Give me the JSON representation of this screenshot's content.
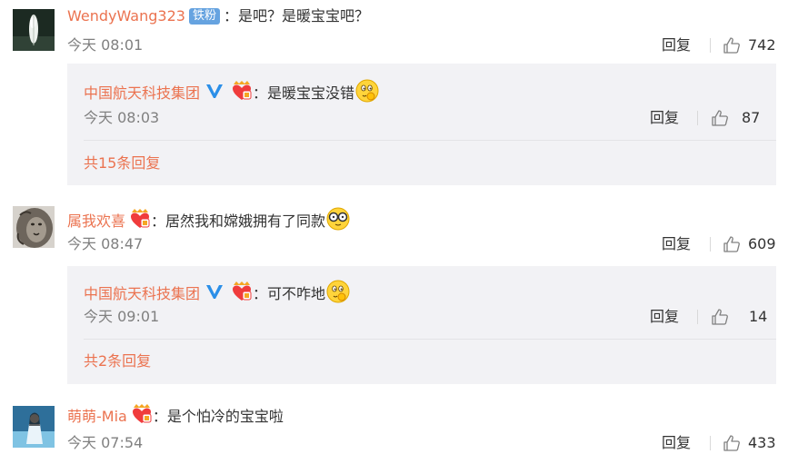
{
  "comments": [
    {
      "username": "WendyWang323",
      "badge": "铁粉",
      "separator": "：",
      "text": "是吧？是暖宝宝吧？",
      "time": "今天 08:01",
      "reply_label": "回复",
      "likes": "742",
      "avatar": "feather-avatar",
      "replies": [
        {
          "username": "中国航天科技集团",
          "separator": "：",
          "text": "是暖宝宝没错",
          "emoji": "thinking-emoji",
          "time": "今天 08:03",
          "reply_label": "回复",
          "likes": "87"
        }
      ],
      "more_label": "共15条回复"
    },
    {
      "username": "属我欢喜",
      "separator": "：",
      "text": "居然我和嫦娥拥有了同款",
      "emoji": "glasses-emoji",
      "time": "今天 08:47",
      "reply_label": "回复",
      "likes": "609",
      "avatar": "lion-avatar",
      "replies": [
        {
          "username": "中国航天科技集团",
          "separator": "：",
          "text": "可不咋地",
          "emoji": "thinking-emoji",
          "time": "今天 09:01",
          "reply_label": "回复",
          "likes": "14"
        }
      ],
      "more_label": "共2条回复"
    },
    {
      "username": "萌萌-Mia",
      "separator": "：",
      "text": "是个怕冷的宝宝啦",
      "time": "今天 07:54",
      "reply_label": "回复",
      "likes": "433",
      "avatar": "girl-avatar"
    }
  ],
  "colors": {
    "username": "#eb7350",
    "reply_box_bg": "#f2f2f5",
    "time": "#808080",
    "verified_blue": "#2b8fe8",
    "iron_badge": "#66a3e0"
  }
}
